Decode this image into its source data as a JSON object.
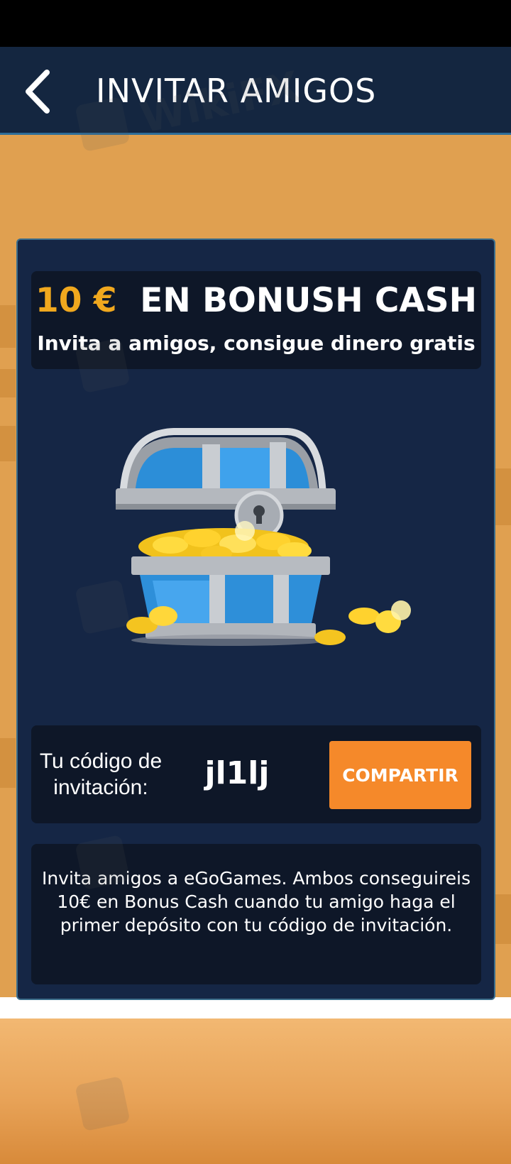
{
  "header": {
    "title": "INVITAR AMIGOS",
    "back_icon": "chevron-left-icon"
  },
  "promo": {
    "amount": "10 €",
    "title_rest": "EN BONUSH CASH",
    "subtitle": "Invita a amigos, consigue dinero gratis"
  },
  "illustration": {
    "name": "treasure-chest-with-coins"
  },
  "invite_code": {
    "label": "Tu código de invitación:",
    "value": "jl1lj",
    "share_label": "COMPARTIR"
  },
  "info": {
    "text": "Invita amigos a eGoGames. Ambos conseguireis 10€ en Bonus Cash cuando tu amigo haga el primer depósito con tu código de invitación."
  },
  "watermark": {
    "text": "WikiFX"
  },
  "colors": {
    "background": "#E0A050",
    "header_bg": "#142640",
    "card_bg": "#152645",
    "box_bg": "#0E1728",
    "accent_gold": "#F0A81E",
    "button_orange": "#F5892A"
  }
}
